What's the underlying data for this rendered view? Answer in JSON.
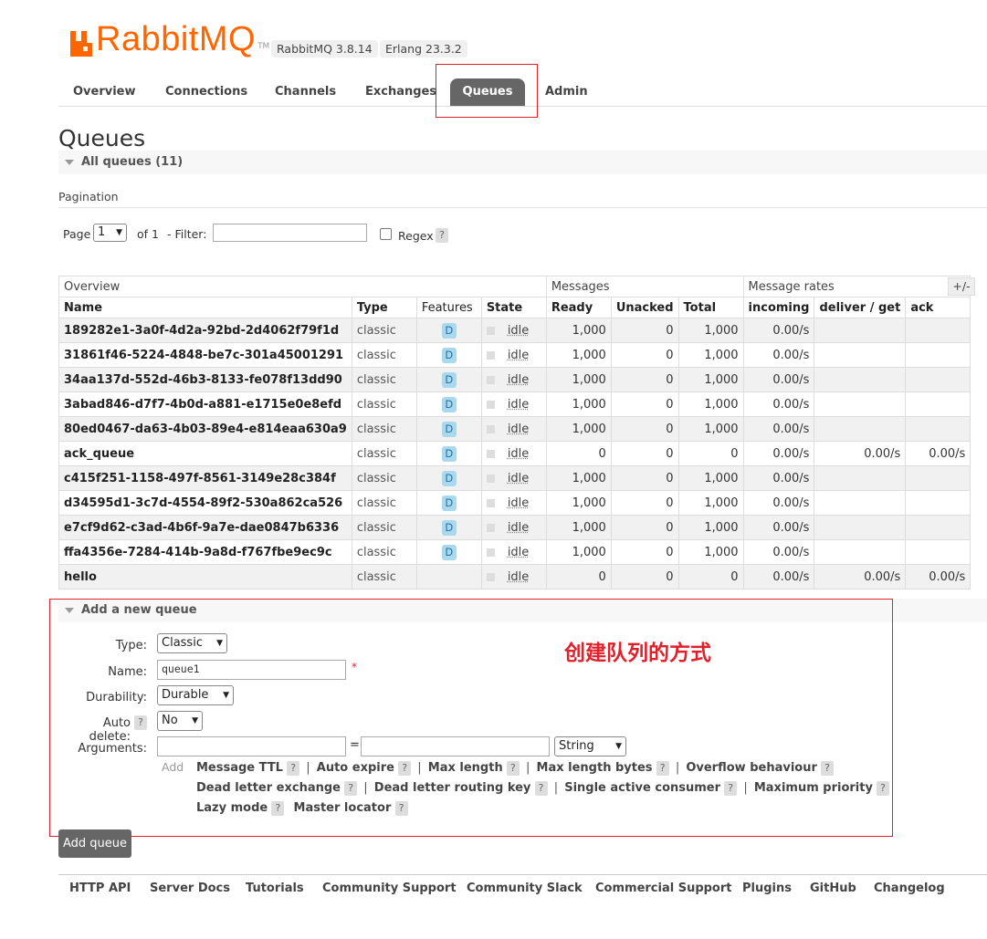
{
  "header": {
    "brand": "RabbitMQ",
    "tm": "TM",
    "version": "RabbitMQ 3.8.14",
    "erlang": "Erlang 23.3.2",
    "brand_color": "#ff6600"
  },
  "nav": {
    "tabs": [
      "Overview",
      "Connections",
      "Channels",
      "Exchanges",
      "Queues",
      "Admin"
    ],
    "active": "Queues"
  },
  "page": {
    "title": "Queues",
    "all_queues_label": "All queues (11)",
    "pagination_label": "Pagination"
  },
  "pagination": {
    "page_label": "Page",
    "page_value": "1",
    "of_label": "of 1",
    "filter_label": "- Filter:",
    "filter_value": "",
    "regex_label": "Regex",
    "help": "?"
  },
  "table": {
    "group_headers": [
      "Overview",
      "Messages",
      "Message rates"
    ],
    "columns": [
      "Name",
      "Type",
      "Features",
      "State",
      "Ready",
      "Unacked",
      "Total",
      "incoming",
      "deliver / get",
      "ack"
    ],
    "toggle_columns": "+/-",
    "rows": [
      {
        "name": "189282e1-3a0f-4d2a-92bd-2d4062f79f1d",
        "type": "classic",
        "feature": "D",
        "state": "idle",
        "ready": "1,000",
        "unacked": "0",
        "total": "1,000",
        "incoming": "0.00/s",
        "deliver": "",
        "ack": ""
      },
      {
        "name": "31861f46-5224-4848-be7c-301a45001291",
        "type": "classic",
        "feature": "D",
        "state": "idle",
        "ready": "1,000",
        "unacked": "0",
        "total": "1,000",
        "incoming": "0.00/s",
        "deliver": "",
        "ack": ""
      },
      {
        "name": "34aa137d-552d-46b3-8133-fe078f13dd90",
        "type": "classic",
        "feature": "D",
        "state": "idle",
        "ready": "1,000",
        "unacked": "0",
        "total": "1,000",
        "incoming": "0.00/s",
        "deliver": "",
        "ack": ""
      },
      {
        "name": "3abad846-d7f7-4b0d-a881-e1715e0e8efd",
        "type": "classic",
        "feature": "D",
        "state": "idle",
        "ready": "1,000",
        "unacked": "0",
        "total": "1,000",
        "incoming": "0.00/s",
        "deliver": "",
        "ack": ""
      },
      {
        "name": "80ed0467-da63-4b03-89e4-e814eaa630a9",
        "type": "classic",
        "feature": "D",
        "state": "idle",
        "ready": "1,000",
        "unacked": "0",
        "total": "1,000",
        "incoming": "0.00/s",
        "deliver": "",
        "ack": ""
      },
      {
        "name": "ack_queue",
        "type": "classic",
        "feature": "D",
        "state": "idle",
        "ready": "0",
        "unacked": "0",
        "total": "0",
        "incoming": "0.00/s",
        "deliver": "0.00/s",
        "ack": "0.00/s"
      },
      {
        "name": "c415f251-1158-497f-8561-3149e28c384f",
        "type": "classic",
        "feature": "D",
        "state": "idle",
        "ready": "1,000",
        "unacked": "0",
        "total": "1,000",
        "incoming": "0.00/s",
        "deliver": "",
        "ack": ""
      },
      {
        "name": "d34595d1-3c7d-4554-89f2-530a862ca526",
        "type": "classic",
        "feature": "D",
        "state": "idle",
        "ready": "1,000",
        "unacked": "0",
        "total": "1,000",
        "incoming": "0.00/s",
        "deliver": "",
        "ack": ""
      },
      {
        "name": "e7cf9d62-c3ad-4b6f-9a7e-dae0847b6336",
        "type": "classic",
        "feature": "D",
        "state": "idle",
        "ready": "1,000",
        "unacked": "0",
        "total": "1,000",
        "incoming": "0.00/s",
        "deliver": "",
        "ack": ""
      },
      {
        "name": "ffa4356e-7284-414b-9a8d-f767fbe9ec9c",
        "type": "classic",
        "feature": "D",
        "state": "idle",
        "ready": "1,000",
        "unacked": "0",
        "total": "1,000",
        "incoming": "0.00/s",
        "deliver": "",
        "ack": ""
      },
      {
        "name": "hello",
        "type": "classic",
        "feature": "",
        "state": "idle",
        "ready": "0",
        "unacked": "0",
        "total": "0",
        "incoming": "0.00/s",
        "deliver": "0.00/s",
        "ack": "0.00/s"
      }
    ]
  },
  "add_queue": {
    "section_label": "Add a new queue",
    "type_label": "Type:",
    "type_value": "Classic",
    "name_label": "Name:",
    "name_value": "queue1",
    "required_mark": "*",
    "durability_label": "Durability:",
    "durability_value": "Durable",
    "auto_delete_label": "Auto delete:",
    "auto_delete_value": "No",
    "arguments_label": "Arguments:",
    "arg_key": "",
    "arg_equals": "=",
    "arg_value": "",
    "arg_type": "String",
    "add_label": "Add",
    "arg_links": [
      "Message TTL",
      "Auto expire",
      "Max length",
      "Max length bytes",
      "Overflow behaviour",
      "Dead letter exchange",
      "Dead letter routing key",
      "Single active consumer",
      "Maximum priority",
      "Lazy mode",
      "Master locator"
    ],
    "separator": "|",
    "help": "?",
    "submit_label": "Add queue"
  },
  "annotation": {
    "text": "创建队列的方式",
    "color": "#e0202a"
  },
  "footer": {
    "links": [
      "HTTP API",
      "Server Docs",
      "Tutorials",
      "Community Support",
      "Community Slack",
      "Commercial Support",
      "Plugins",
      "GitHub",
      "Changelog"
    ]
  }
}
